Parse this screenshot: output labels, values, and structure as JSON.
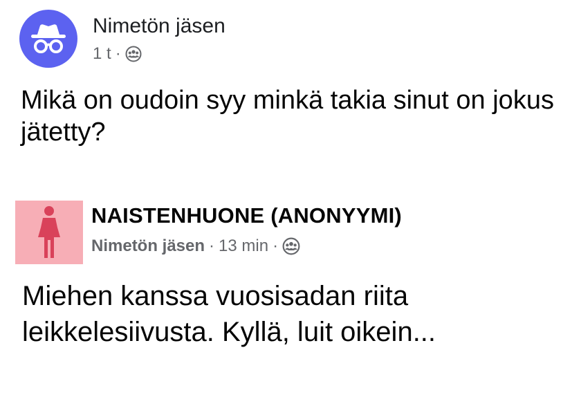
{
  "post": {
    "author": "Nimetön jäsen",
    "time": "1 t",
    "separator": "·",
    "audience_icon": "group-audience-icon",
    "avatar_icon": "incognito-icon",
    "question": "Mikä on oudoin syy minkä takia sinut on jokus jätetty?"
  },
  "shared_post": {
    "group_name": "NAISTENHUONE (ANONYYMI)",
    "group_avatar_icon": "woman-figure-icon",
    "author": "Nimetön jäsen",
    "separator": "·",
    "time": "13 min",
    "audience_icon": "group-audience-icon",
    "body": "Miehen kanssa vuosisadan riita leikkelesiivusta. Kyllä, luit oikein..."
  },
  "colors": {
    "anon_avatar_bg": "#5c62f0",
    "group_avatar_bg": "#f7aeb6",
    "figure_color": "#d9425a",
    "secondary_text": "#65676b"
  }
}
